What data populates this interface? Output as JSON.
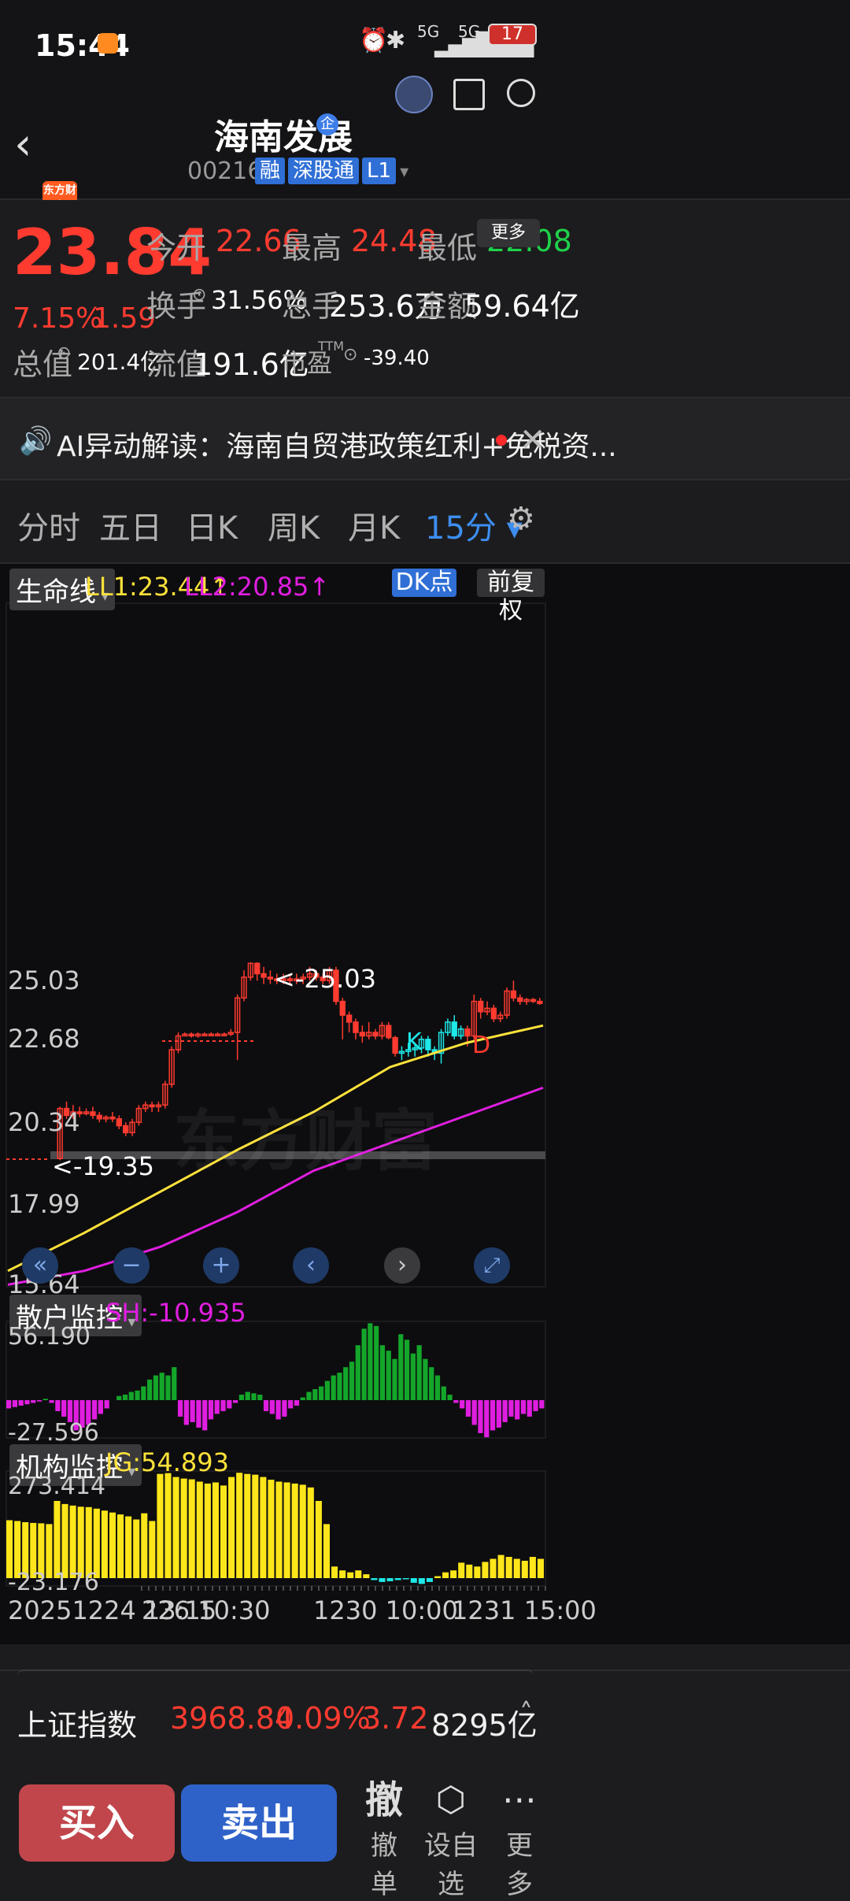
{
  "status_bar": {
    "time": "15:44",
    "battery": "17",
    "net1": "5G",
    "net2": "5G"
  },
  "header": {
    "title": "海南发展",
    "title_badge": "企",
    "code": "002163",
    "tags": [
      "融",
      "深股通",
      "L1"
    ],
    "app_logo": "东方财富"
  },
  "quote": {
    "price": "23.84",
    "change_pct": "7.15%",
    "change_abs": "1.59",
    "open_label": "今开",
    "open": "22.66",
    "high_label": "最高",
    "high": "24.48",
    "low_label": "最低",
    "low": "22.08",
    "turnover_label": "换手",
    "turnover": "31.56%",
    "volume_label": "总手",
    "volume": "253.6万",
    "amount_label": "金额",
    "amount": "59.64亿",
    "mktcap_label": "总值",
    "mktcap": "201.4亿",
    "float_label": "流值",
    "float": "191.6亿",
    "pe_label": "市盈",
    "pe_sup": "TTM",
    "pe": "-39.40",
    "more_button": "更多"
  },
  "ticker": {
    "text": "AI异动解读：海南自贸港政策红利+免税资..."
  },
  "tabs": [
    {
      "label": "分时"
    },
    {
      "label": "五日"
    },
    {
      "label": "日K"
    },
    {
      "label": "周K"
    },
    {
      "label": "月K"
    },
    {
      "label": "15分 ▾"
    }
  ],
  "main_chart": {
    "indicator": "生命线",
    "ll1": "LL1:23.44↑",
    "ll2": "LL2:20.85↑",
    "dk_button": "DK点",
    "adjust_button": "前复权",
    "y_labels": [
      "25.03",
      "22.68",
      "20.34",
      "17.99",
      "15.64"
    ],
    "high_mark": "<-25.03",
    "low_mark": "<-19.35",
    "k_mark": "K",
    "d_mark": "D",
    "watermark": "东方财富"
  },
  "sh_panel": {
    "indicator": "散户监控",
    "value": "SH:-10.935",
    "y_top": "56.190",
    "y_bottom": "-27.596"
  },
  "jg_panel": {
    "indicator": "机构监控",
    "value": "JG:54.893",
    "y_top": "273.414",
    "y_bottom": "-23.176"
  },
  "x_axis": {
    "left": "20251224 13:15",
    "mid1": "226 10:30",
    "mid2": "1230 10:00",
    "right": "1231 15:00"
  },
  "index_bar": {
    "name": "上证指数",
    "value": "3968.84",
    "pct": "0.09%",
    "chg": "3.72",
    "amount": "8295亿"
  },
  "actions": {
    "buy": "买入",
    "sell": "卖出",
    "cancel_icon": "撤",
    "cancel": "撤单",
    "watch": "设自选",
    "more": "更多"
  },
  "colors": {
    "up": "#ff3b30",
    "down": "#1fd14a",
    "ll1": "#ffe23a",
    "ll2": "#e01ee0",
    "buy": "#c0464b",
    "sell": "#2f62c9"
  },
  "chart_data": {
    "type": "bar",
    "candles": [
      [
        19.35,
        20.8,
        20.85,
        19.3
      ],
      [
        20.8,
        20.6,
        21.0,
        20.5
      ],
      [
        20.6,
        20.7,
        20.9,
        20.5
      ],
      [
        20.7,
        20.65,
        20.85,
        20.55
      ],
      [
        20.65,
        20.7,
        20.8,
        20.6
      ],
      [
        20.7,
        20.6,
        20.85,
        20.5
      ],
      [
        20.6,
        20.5,
        20.7,
        20.4
      ],
      [
        20.5,
        20.55,
        20.6,
        20.4
      ],
      [
        20.55,
        20.5,
        20.7,
        20.4
      ],
      [
        20.5,
        20.3,
        20.6,
        20.2
      ],
      [
        20.3,
        20.1,
        20.4,
        20.0
      ],
      [
        20.1,
        20.4,
        20.5,
        20.0
      ],
      [
        20.4,
        20.8,
        20.9,
        20.3
      ],
      [
        20.8,
        20.9,
        21.0,
        20.7
      ],
      [
        20.9,
        20.85,
        21.0,
        20.7
      ],
      [
        20.85,
        20.9,
        21.0,
        20.7
      ],
      [
        20.9,
        21.5,
        21.6,
        20.8
      ],
      [
        21.5,
        22.5,
        22.6,
        21.4
      ],
      [
        22.5,
        22.9,
        23.0,
        22.4
      ],
      [
        22.9,
        22.95,
        23.0,
        22.9
      ],
      [
        22.95,
        22.9,
        23.0,
        22.85
      ],
      [
        22.9,
        22.95,
        23.0,
        22.85
      ],
      [
        22.95,
        22.95,
        23.0,
        22.9
      ],
      [
        22.95,
        22.95,
        23.0,
        22.9
      ],
      [
        22.95,
        22.95,
        23.0,
        22.9
      ],
      [
        22.95,
        22.95,
        23.0,
        22.9
      ],
      [
        22.95,
        23.0,
        23.1,
        22.9
      ],
      [
        23.0,
        24.0,
        24.1,
        22.2
      ],
      [
        24.0,
        24.6,
        24.8,
        23.9
      ],
      [
        24.6,
        25.0,
        25.03,
        24.5
      ],
      [
        25.0,
        24.7,
        25.03,
        24.5
      ],
      [
        24.7,
        24.6,
        24.9,
        24.4
      ],
      [
        24.6,
        24.55,
        24.8,
        24.4
      ],
      [
        24.55,
        24.5,
        24.7,
        24.4
      ],
      [
        24.5,
        24.55,
        24.7,
        24.4
      ],
      [
        24.55,
        24.5,
        24.7,
        24.4
      ],
      [
        24.5,
        24.55,
        24.7,
        24.4
      ],
      [
        24.55,
        24.6,
        24.7,
        24.4
      ],
      [
        24.6,
        24.7,
        24.9,
        24.5
      ],
      [
        24.7,
        24.6,
        24.8,
        24.5
      ],
      [
        24.6,
        24.5,
        24.7,
        24.4
      ],
      [
        24.5,
        24.8,
        24.9,
        24.4
      ],
      [
        24.8,
        23.9,
        24.9,
        23.8
      ],
      [
        23.9,
        23.5,
        24.0,
        22.8
      ],
      [
        23.5,
        23.3,
        23.6,
        23.0
      ],
      [
        23.3,
        23.0,
        23.4,
        22.8
      ],
      [
        23.0,
        22.9,
        23.2,
        22.7
      ],
      [
        22.9,
        23.0,
        23.3,
        22.8
      ],
      [
        23.0,
        22.9,
        23.1,
        22.8
      ],
      [
        22.9,
        23.2,
        23.3,
        22.8
      ],
      [
        23.2,
        22.85,
        23.3,
        22.8
      ],
      [
        22.85,
        22.4,
        22.9,
        22.3
      ],
      [
        22.4,
        22.45,
        22.6,
        22.2
      ],
      [
        22.45,
        22.5,
        22.7,
        22.3
      ],
      [
        22.5,
        22.55,
        22.7,
        22.3
      ],
      [
        22.55,
        22.8,
        22.9,
        22.4
      ],
      [
        22.8,
        22.5,
        22.9,
        22.3
      ],
      [
        22.5,
        22.4,
        22.6,
        22.2
      ],
      [
        22.4,
        23.0,
        23.1,
        22.1
      ],
      [
        23.0,
        23.3,
        23.4,
        22.9
      ],
      [
        23.3,
        22.9,
        23.5,
        22.8
      ],
      [
        22.9,
        23.1,
        23.2,
        22.8
      ],
      [
        23.1,
        22.9,
        23.2,
        22.6
      ],
      [
        22.9,
        23.9,
        24.1,
        22.8
      ],
      [
        23.9,
        23.6,
        24.0,
        23.4
      ],
      [
        23.6,
        23.7,
        23.9,
        23.5
      ],
      [
        23.7,
        23.4,
        23.8,
        23.3
      ],
      [
        23.4,
        23.5,
        23.6,
        23.3
      ],
      [
        23.5,
        24.2,
        24.3,
        23.4
      ],
      [
        24.2,
        24.0,
        24.5,
        23.9
      ],
      [
        24.0,
        23.9,
        24.1,
        23.8
      ],
      [
        23.9,
        23.95,
        24.0,
        23.8
      ],
      [
        23.95,
        23.9,
        24.0,
        23.85
      ],
      [
        23.9,
        23.84,
        24.0,
        23.8
      ]
    ],
    "ll1": [
      16.1,
      17.2,
      18.4,
      19.6,
      20.7,
      22.0,
      22.7,
      23.2,
      23.44
    ],
    "ll2": [
      15.7,
      16.1,
      16.8,
      17.8,
      19.0,
      19.8,
      20.6,
      21.4,
      20.85
    ],
    "sh": [
      -6,
      -5,
      -4,
      -3,
      -2,
      -1,
      1,
      -2,
      -8,
      -12,
      -16,
      -22,
      -20,
      -18,
      -14,
      -10,
      -6,
      0,
      3,
      4,
      6,
      7,
      10,
      15,
      18,
      20,
      18,
      24,
      -12,
      -18,
      -16,
      -20,
      -22,
      -14,
      -10,
      -8,
      -6,
      -2,
      4,
      6,
      5,
      4,
      -8,
      -10,
      -14,
      -12,
      -6,
      -4,
      2,
      6,
      8,
      10,
      14,
      18,
      20,
      24,
      28,
      40,
      52,
      56,
      54,
      40,
      36,
      30,
      48,
      44,
      34,
      40,
      30,
      24,
      18,
      10,
      4,
      -2,
      -6,
      -12,
      -18,
      -24,
      -27,
      -22,
      -20,
      -16,
      -12,
      -14,
      -10,
      -12,
      -8,
      -6
    ],
    "jg": [
      150,
      148,
      145,
      143,
      142,
      140,
      200,
      192,
      188,
      185,
      184,
      180,
      175,
      170,
      165,
      160,
      152,
      168,
      148,
      270,
      272,
      262,
      258,
      256,
      250,
      245,
      248,
      240,
      262,
      273,
      270,
      268,
      262,
      255,
      250,
      248,
      245,
      242,
      235,
      200,
      140,
      30,
      20,
      15,
      20,
      10,
      -5,
      -10,
      -8,
      -5,
      -3,
      -12,
      -15,
      -10,
      5,
      15,
      20,
      40,
      35,
      30,
      42,
      50,
      60,
      55,
      50,
      45,
      55,
      50
    ],
    "ylim": [
      15.64,
      25.03
    ]
  }
}
